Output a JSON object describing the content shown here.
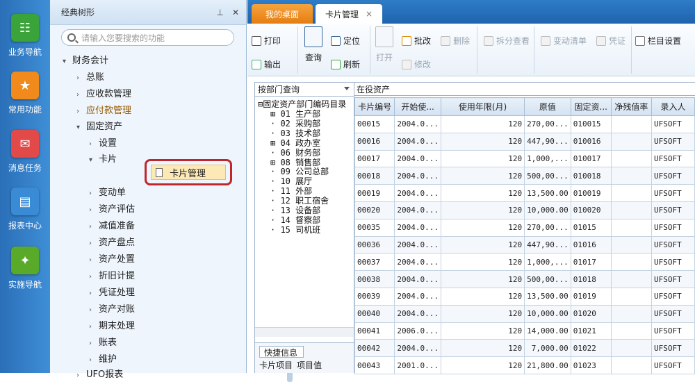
{
  "nav": [
    {
      "label": "业务导航",
      "icon": "business-nav-icon",
      "color": "#3aa33a"
    },
    {
      "label": "常用功能",
      "icon": "star-icon",
      "color": "#f08a1c"
    },
    {
      "label": "消息任务",
      "icon": "message-icon",
      "color": "#e24a4a"
    },
    {
      "label": "报表中心",
      "icon": "report-icon",
      "color": "#3a8bd6"
    },
    {
      "label": "实施导航",
      "icon": "compass-icon",
      "color": "#5aaa2a"
    }
  ],
  "tree": {
    "header": "经典树形",
    "search_placeholder": "请输入您要搜索的功能",
    "items": [
      {
        "label": "财务会计"
      },
      {
        "label": "总账"
      },
      {
        "label": "应收款管理"
      },
      {
        "label": "应付款管理"
      },
      {
        "label": "固定资产"
      },
      {
        "label": "设置"
      },
      {
        "label": "卡片"
      },
      {
        "label": "卡片管理"
      },
      {
        "label": "变动单"
      },
      {
        "label": "资产评估"
      },
      {
        "label": "减值准备"
      },
      {
        "label": "资产盘点"
      },
      {
        "label": "资产处置"
      },
      {
        "label": "折旧计提"
      },
      {
        "label": "凭证处理"
      },
      {
        "label": "资产对账"
      },
      {
        "label": "期末处理"
      },
      {
        "label": "账表"
      },
      {
        "label": "维护"
      },
      {
        "label": "UFO报表"
      }
    ]
  },
  "tabs": {
    "desk": "我的桌面",
    "card": "卡片管理",
    "close": "×"
  },
  "toolbar": {
    "print": "打印",
    "output": "输出",
    "query": "查询",
    "locate": "定位",
    "refresh": "刷新",
    "open": "打开",
    "approve": "批改",
    "modify": "修改",
    "delete": "删除",
    "split": "拆分查看",
    "changelist": "变动清单",
    "voucher": "凭证",
    "columns": "栏目设置"
  },
  "left": {
    "combo": "按部门查询",
    "root": "固定资产部门编码目录",
    "depts": [
      {
        "label": "01 生产部",
        "exp": "⊞"
      },
      {
        "label": "02 采购部",
        "exp": ""
      },
      {
        "label": "03 技术部",
        "exp": ""
      },
      {
        "label": "04 政办室",
        "exp": "⊞"
      },
      {
        "label": "06 财务部",
        "exp": ""
      },
      {
        "label": "08 销售部",
        "exp": "⊞"
      },
      {
        "label": "09 公司总部",
        "exp": ""
      },
      {
        "label": "10 展厅",
        "exp": ""
      },
      {
        "label": "11 外部",
        "exp": ""
      },
      {
        "label": "12 职工宿舍",
        "exp": ""
      },
      {
        "label": "13 设备部",
        "exp": ""
      },
      {
        "label": "14 督察部",
        "exp": ""
      },
      {
        "label": "15 司机班",
        "exp": ""
      }
    ],
    "quick_title": "快捷信息",
    "quick_cols": [
      "卡片项目",
      "项目值"
    ]
  },
  "grid": {
    "title": "在役资产",
    "columns": [
      "卡片编号",
      "开始使...",
      "使用年限(月)",
      "原值",
      "固定资...",
      "净残值率",
      "录入人"
    ],
    "rows": [
      [
        "00015",
        "2004.0...",
        "120",
        "270,00...",
        "010015",
        "",
        "UFSOFT"
      ],
      [
        "00016",
        "2004.0...",
        "120",
        "447,90...",
        "010016",
        "",
        "UFSOFT"
      ],
      [
        "00017",
        "2004.0...",
        "120",
        "1,000,...",
        "010017",
        "",
        "UFSOFT"
      ],
      [
        "00018",
        "2004.0...",
        "120",
        "500,00...",
        "010018",
        "",
        "UFSOFT"
      ],
      [
        "00019",
        "2004.0...",
        "120",
        "13,500.00",
        "010019",
        "",
        "UFSOFT"
      ],
      [
        "00020",
        "2004.0...",
        "120",
        "10,000.00",
        "010020",
        "",
        "UFSOFT"
      ],
      [
        "00035",
        "2004.0...",
        "120",
        "270,00...",
        "01015",
        "",
        "UFSOFT"
      ],
      [
        "00036",
        "2004.0...",
        "120",
        "447,90...",
        "01016",
        "",
        "UFSOFT"
      ],
      [
        "00037",
        "2004.0...",
        "120",
        "1,000,...",
        "01017",
        "",
        "UFSOFT"
      ],
      [
        "00038",
        "2004.0...",
        "120",
        "500,00...",
        "01018",
        "",
        "UFSOFT"
      ],
      [
        "00039",
        "2004.0...",
        "120",
        "13,500.00",
        "01019",
        "",
        "UFSOFT"
      ],
      [
        "00040",
        "2004.0...",
        "120",
        "10,000.00",
        "01020",
        "",
        "UFSOFT"
      ],
      [
        "00041",
        "2006.0...",
        "120",
        "14,000.00",
        "01021",
        "",
        "UFSOFT"
      ],
      [
        "00042",
        "2004.0...",
        "120",
        "7,000.00",
        "01022",
        "",
        "UFSOFT"
      ],
      [
        "00043",
        "2001.0...",
        "120",
        "21,800.00",
        "01023",
        "",
        "UFSOFT"
      ]
    ]
  }
}
